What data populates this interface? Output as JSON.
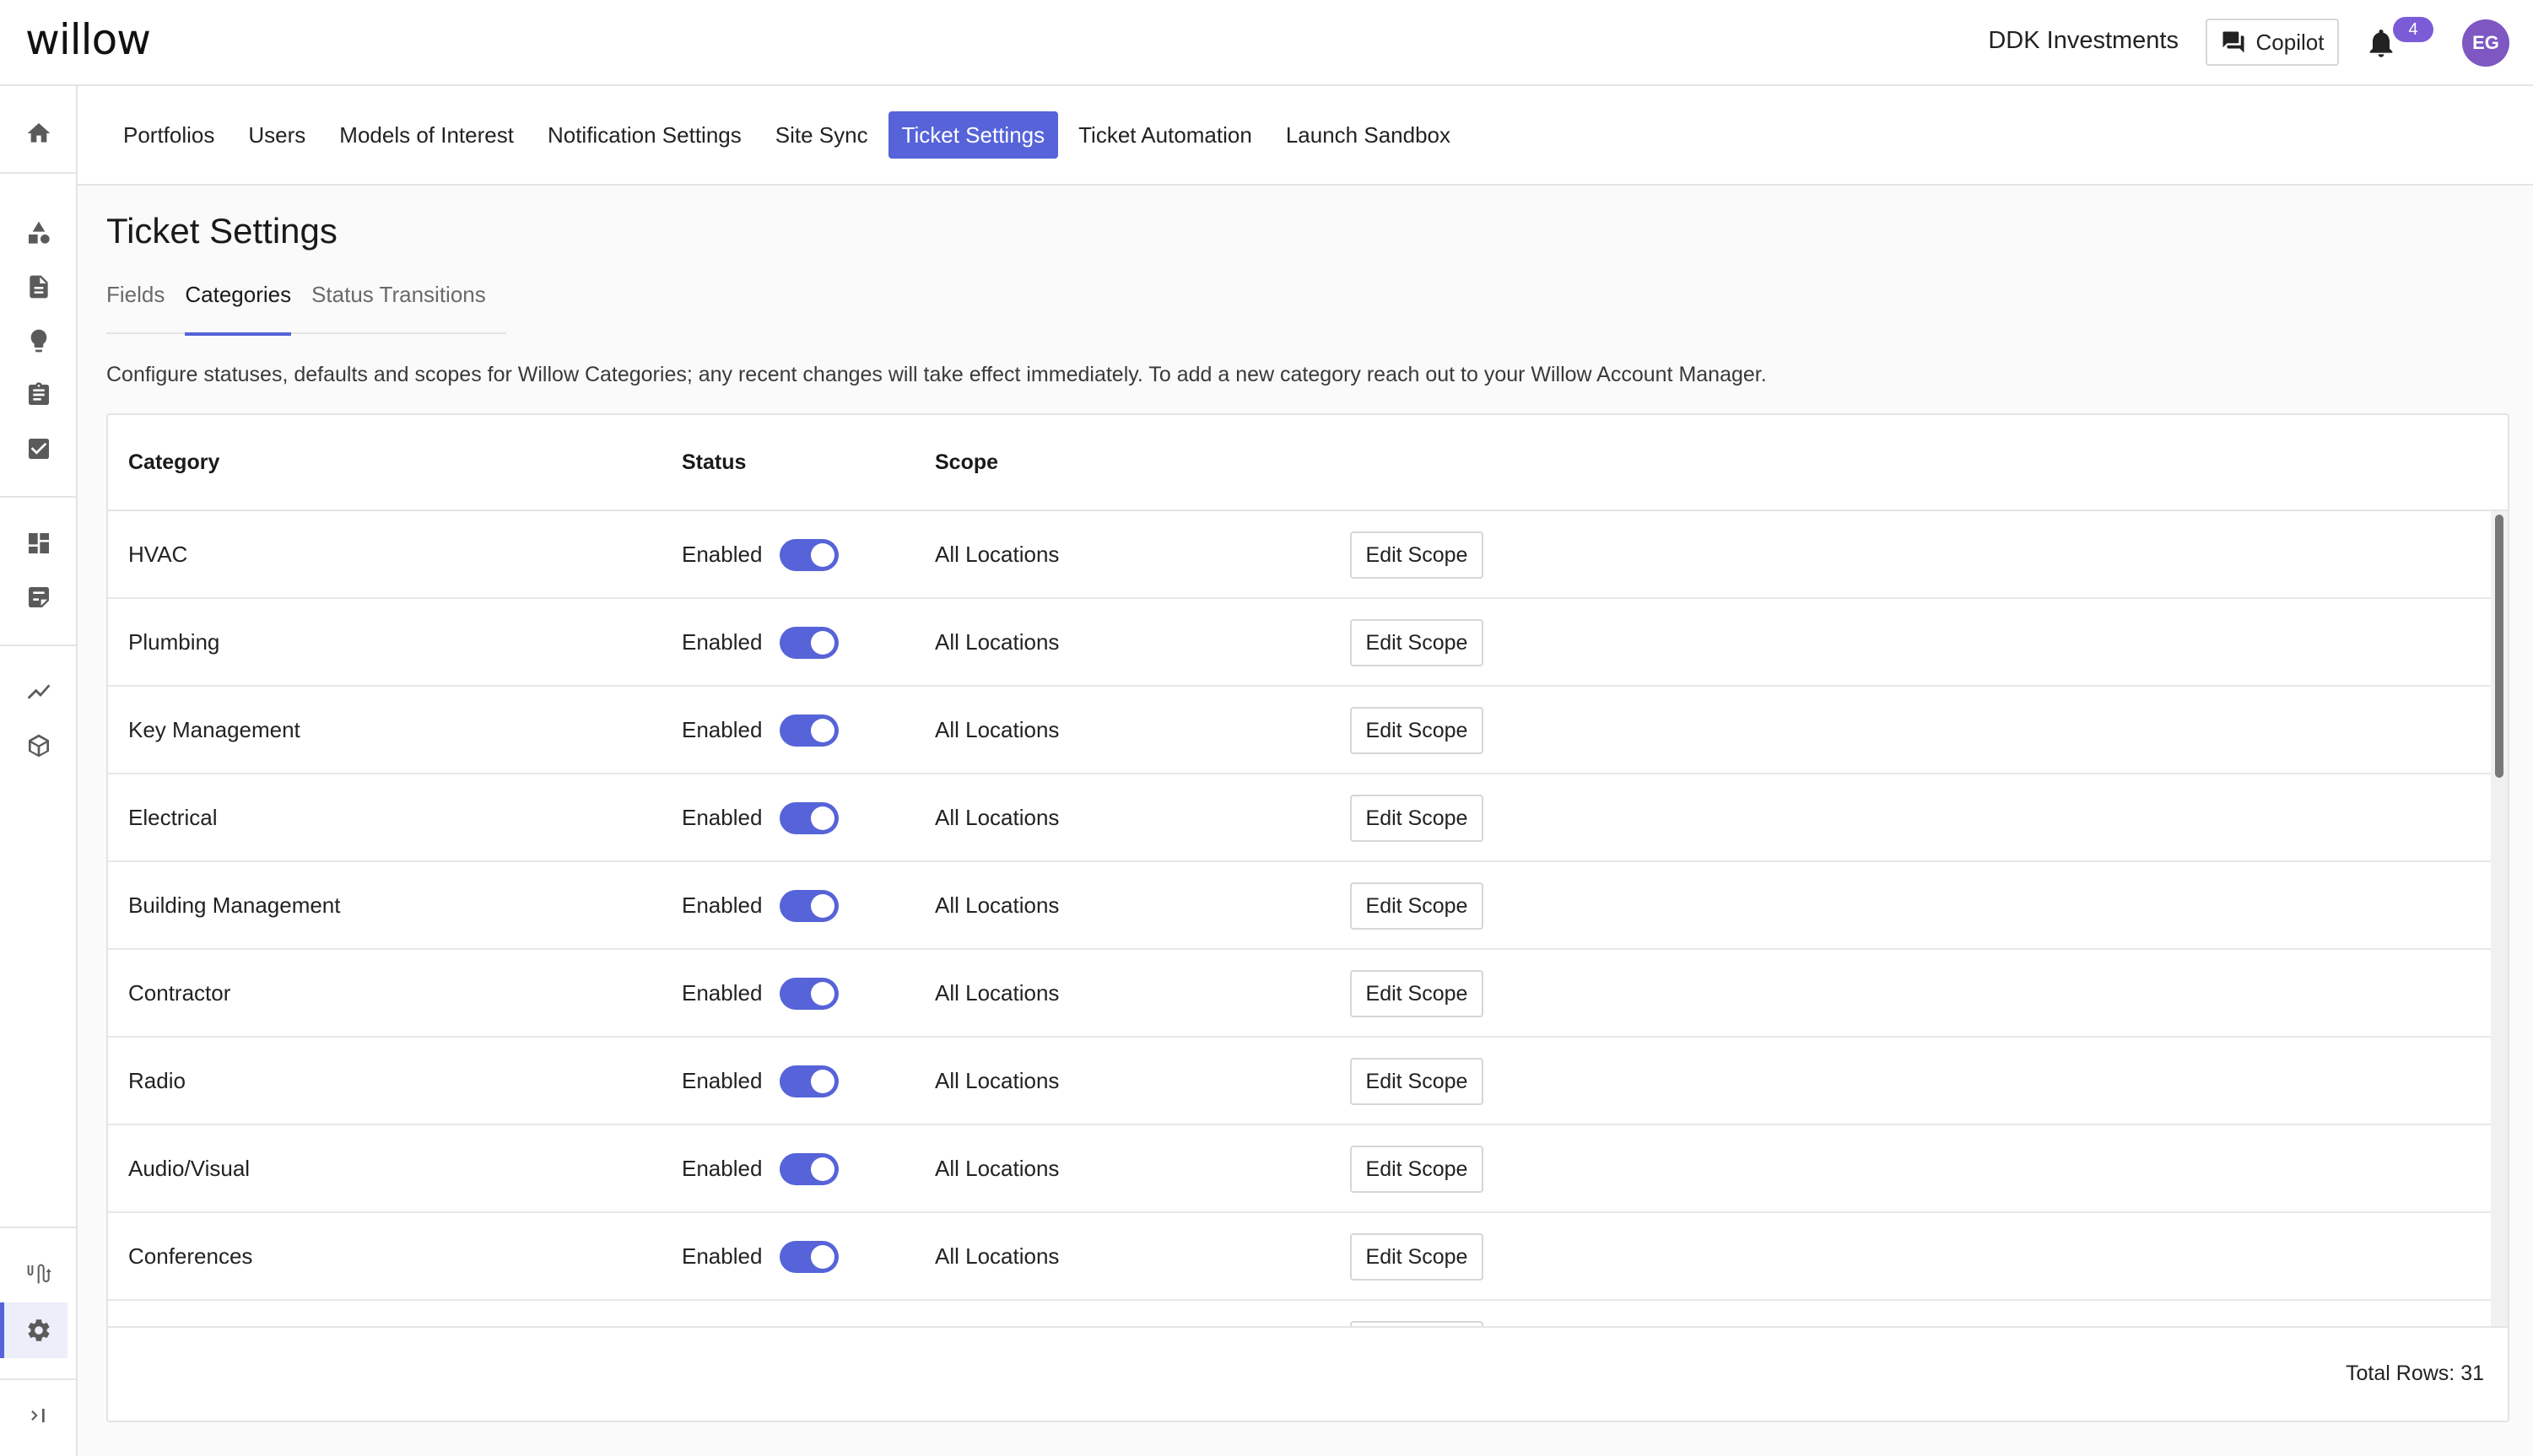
{
  "header": {
    "logo": "willow",
    "org_name": "DDK Investments",
    "copilot_label": "Copilot",
    "notification_count": "4",
    "avatar_initials": "EG"
  },
  "rail": {
    "icons": [
      "home-icon",
      "shapes-icon",
      "document-icon",
      "lightbulb-icon",
      "clipboard-icon",
      "checkbox-icon",
      "dashboard-icon",
      "report-icon",
      "trend-icon",
      "cube-icon",
      "connectors-icon",
      "gear-icon",
      "expand-icon"
    ]
  },
  "settings_nav": {
    "items": [
      "Portfolios",
      "Users",
      "Models of Interest",
      "Notification Settings",
      "Site Sync",
      "Ticket Settings",
      "Ticket Automation",
      "Launch Sandbox"
    ],
    "active": "Ticket Settings"
  },
  "page": {
    "title": "Ticket Settings",
    "tabs": [
      "Fields",
      "Categories",
      "Status Transitions"
    ],
    "active_tab": "Categories",
    "description": "Configure statuses, defaults and scopes for Willow Categories; any recent changes will take effect immediately. To add a new category reach out to your Willow Account Manager."
  },
  "table": {
    "headers": {
      "category": "Category",
      "status": "Status",
      "scope": "Scope"
    },
    "rows": [
      {
        "category": "HVAC",
        "status": "Enabled",
        "enabled": true,
        "scope": "All Locations",
        "action": "Edit Scope"
      },
      {
        "category": "Plumbing",
        "status": "Enabled",
        "enabled": true,
        "scope": "All Locations",
        "action": "Edit Scope"
      },
      {
        "category": "Key Management",
        "status": "Enabled",
        "enabled": true,
        "scope": "All Locations",
        "action": "Edit Scope"
      },
      {
        "category": "Electrical",
        "status": "Enabled",
        "enabled": true,
        "scope": "All Locations",
        "action": "Edit Scope"
      },
      {
        "category": "Building Management",
        "status": "Enabled",
        "enabled": true,
        "scope": "All Locations",
        "action": "Edit Scope"
      },
      {
        "category": "Contractor",
        "status": "Enabled",
        "enabled": true,
        "scope": "All Locations",
        "action": "Edit Scope"
      },
      {
        "category": "Radio",
        "status": "Enabled",
        "enabled": true,
        "scope": "All Locations",
        "action": "Edit Scope"
      },
      {
        "category": "Audio/Visual",
        "status": "Enabled",
        "enabled": true,
        "scope": "All Locations",
        "action": "Edit Scope"
      },
      {
        "category": "Conferences",
        "status": "Enabled",
        "enabled": true,
        "scope": "All Locations",
        "action": "Edit Scope"
      },
      {
        "category": "",
        "status": "",
        "enabled": true,
        "scope": "",
        "action": ""
      }
    ],
    "total_rows": "Total Rows: 31"
  },
  "colors": {
    "accent": "#5663d9",
    "avatar": "#7e57c2",
    "badge": "#7b5cd6"
  }
}
